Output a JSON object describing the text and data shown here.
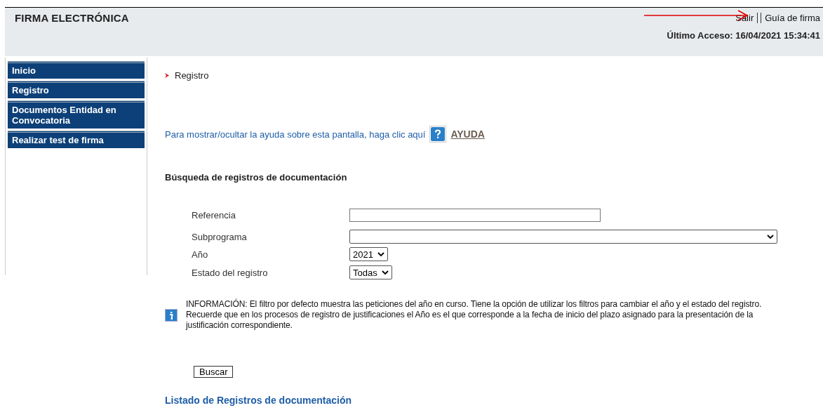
{
  "header": {
    "title": "FIRMA ELECTRÓNICA",
    "links": [
      "Salir",
      "Guía de firma"
    ],
    "last_access": "Último Acceso: 16/04/2021 15:34:41"
  },
  "sidebar": {
    "items": [
      {
        "label": "Inicio"
      },
      {
        "label": "Registro"
      },
      {
        "label": "Documentos Entidad en Convocatoria"
      },
      {
        "label": "Realizar test de firma"
      }
    ]
  },
  "breadcrumb": "Registro",
  "help": {
    "text": "Para mostrar/ocultar la ayuda sobre esta pantalla, haga clic aquí",
    "link": "AYUDA"
  },
  "search": {
    "title": "Búsqueda de registros de documentación",
    "fields": [
      {
        "label": "Referencia",
        "kind": "text"
      },
      {
        "label": "Subprograma",
        "kind": "wide-select"
      },
      {
        "label": "Año",
        "kind": "select",
        "value": "2021"
      },
      {
        "label": "Estado del registro",
        "kind": "select",
        "value": "Todas"
      }
    ],
    "info": "INFORMACIÓN: El filtro por defecto muestra las peticiones del año en curso. Tiene la opción de utilizar los filtros para cambiar el año y el estado del registro. Recuerde que en los procesos de registro de justificaciones el Año es el que corresponde a la fecha de inicio del plazo asignado para la presentación de la justificación correspondiente.",
    "button": "Buscar"
  },
  "list_title": "Listado de Registros de documentación"
}
